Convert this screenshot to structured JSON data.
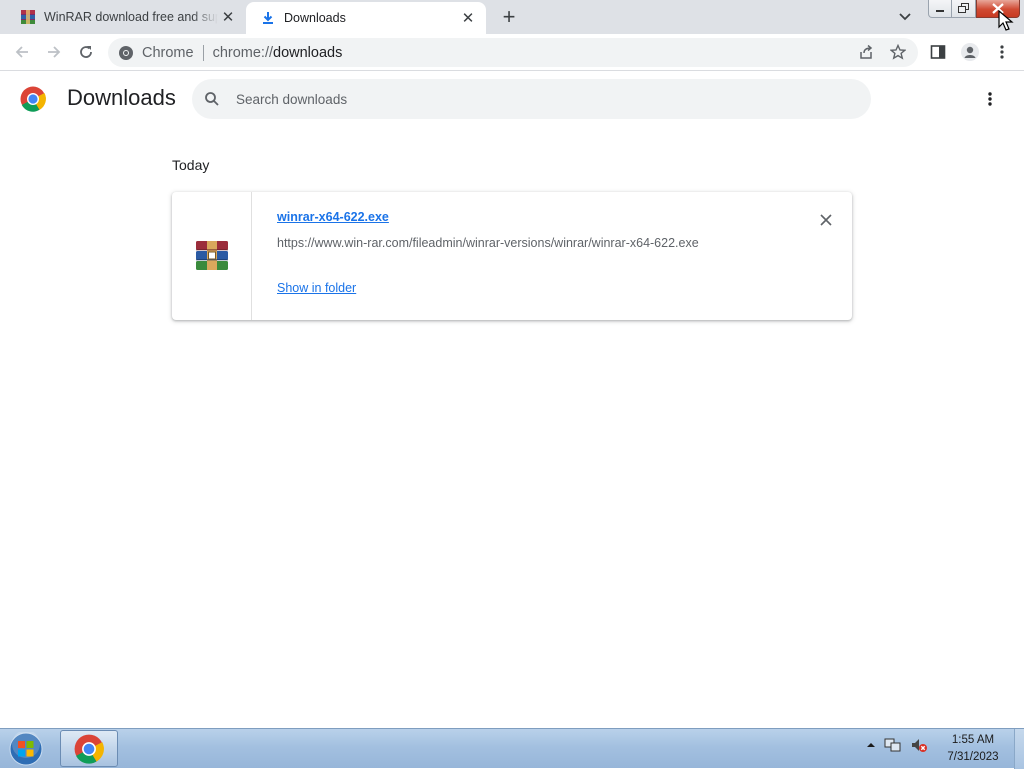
{
  "browser": {
    "tabs": [
      {
        "title": "WinRAR download free and support",
        "active": false,
        "icon": "winrar-icon"
      },
      {
        "title": "Downloads",
        "active": true,
        "icon": "download-icon"
      }
    ],
    "omnibox": {
      "label": "Chrome",
      "scheme": "chrome://",
      "path": "downloads"
    }
  },
  "page": {
    "title": "Downloads",
    "search_placeholder": "Search downloads",
    "section_label": "Today",
    "download": {
      "filename": "winrar-x64-622.exe",
      "url": "https://www.win-rar.com/fileadmin/winrar-versions/winrar/winrar-x64-622.exe",
      "action": "Show in folder"
    }
  },
  "taskbar": {
    "time": "1:55 AM",
    "date": "7/31/2023"
  },
  "colors": {
    "accent": "#1a73e8",
    "tabstrip": "#dee1e6",
    "close_red": "#c73a22"
  }
}
